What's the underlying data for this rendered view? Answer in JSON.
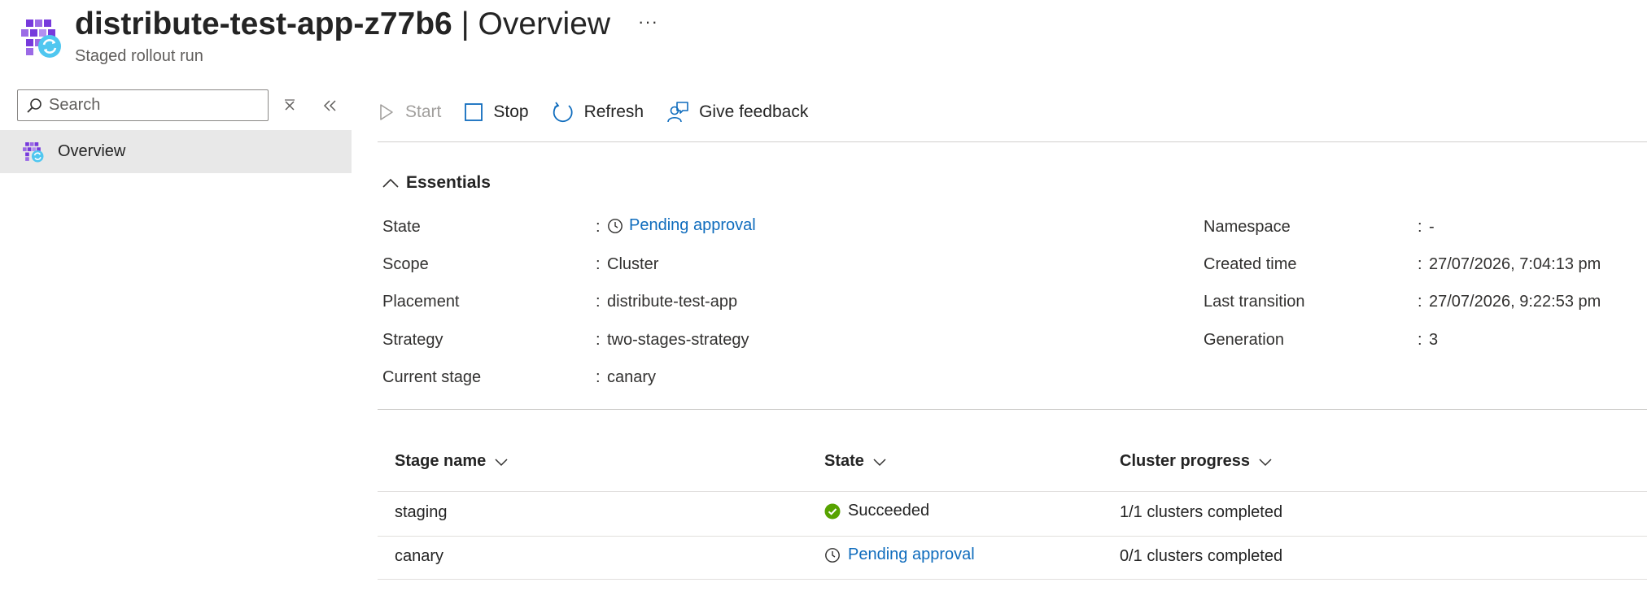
{
  "header": {
    "resource_name": "distribute-test-app-z77b6",
    "separator": "|",
    "blade": "Overview",
    "subtitle": "Staged rollout run",
    "more": "···",
    "icon": "fleet-rollout-icon"
  },
  "sidebar": {
    "search_placeholder": "Search",
    "items": [
      {
        "label": "Overview",
        "icon": "fleet-rollout-icon",
        "selected": true
      }
    ]
  },
  "toolbar": {
    "start": "Start",
    "stop": "Stop",
    "refresh": "Refresh",
    "feedback": "Give feedback"
  },
  "essentials": {
    "title": "Essentials",
    "left": [
      {
        "label": "State",
        "value": "Pending approval",
        "link": true
      },
      {
        "label": "Scope",
        "value": "Cluster"
      },
      {
        "label": "Placement",
        "value": "distribute-test-app"
      },
      {
        "label": "Strategy",
        "value": "two-stages-strategy"
      },
      {
        "label": "Current stage",
        "value": "canary"
      }
    ],
    "right": [
      {
        "label": "Namespace",
        "value": "-"
      },
      {
        "label": "Created time",
        "value": "27/07/2026, 7:04:13 pm"
      },
      {
        "label": "Last transition",
        "value": "27/07/2026, 9:22:53 pm"
      },
      {
        "label": "Generation",
        "value": "3"
      }
    ]
  },
  "table": {
    "columns": [
      "Stage name",
      "State",
      "Cluster progress"
    ],
    "rows": [
      {
        "stage": "staging",
        "state": "Succeeded",
        "progress": "1/1 clusters completed"
      },
      {
        "stage": "canary",
        "state": "Pending approval",
        "progress": "0/1 clusters completed"
      }
    ]
  },
  "colors": {
    "link": "#0f6cbd",
    "success": "#57a300",
    "selected_nav": "#e8e8e8",
    "disabled": "#a19f9d"
  }
}
